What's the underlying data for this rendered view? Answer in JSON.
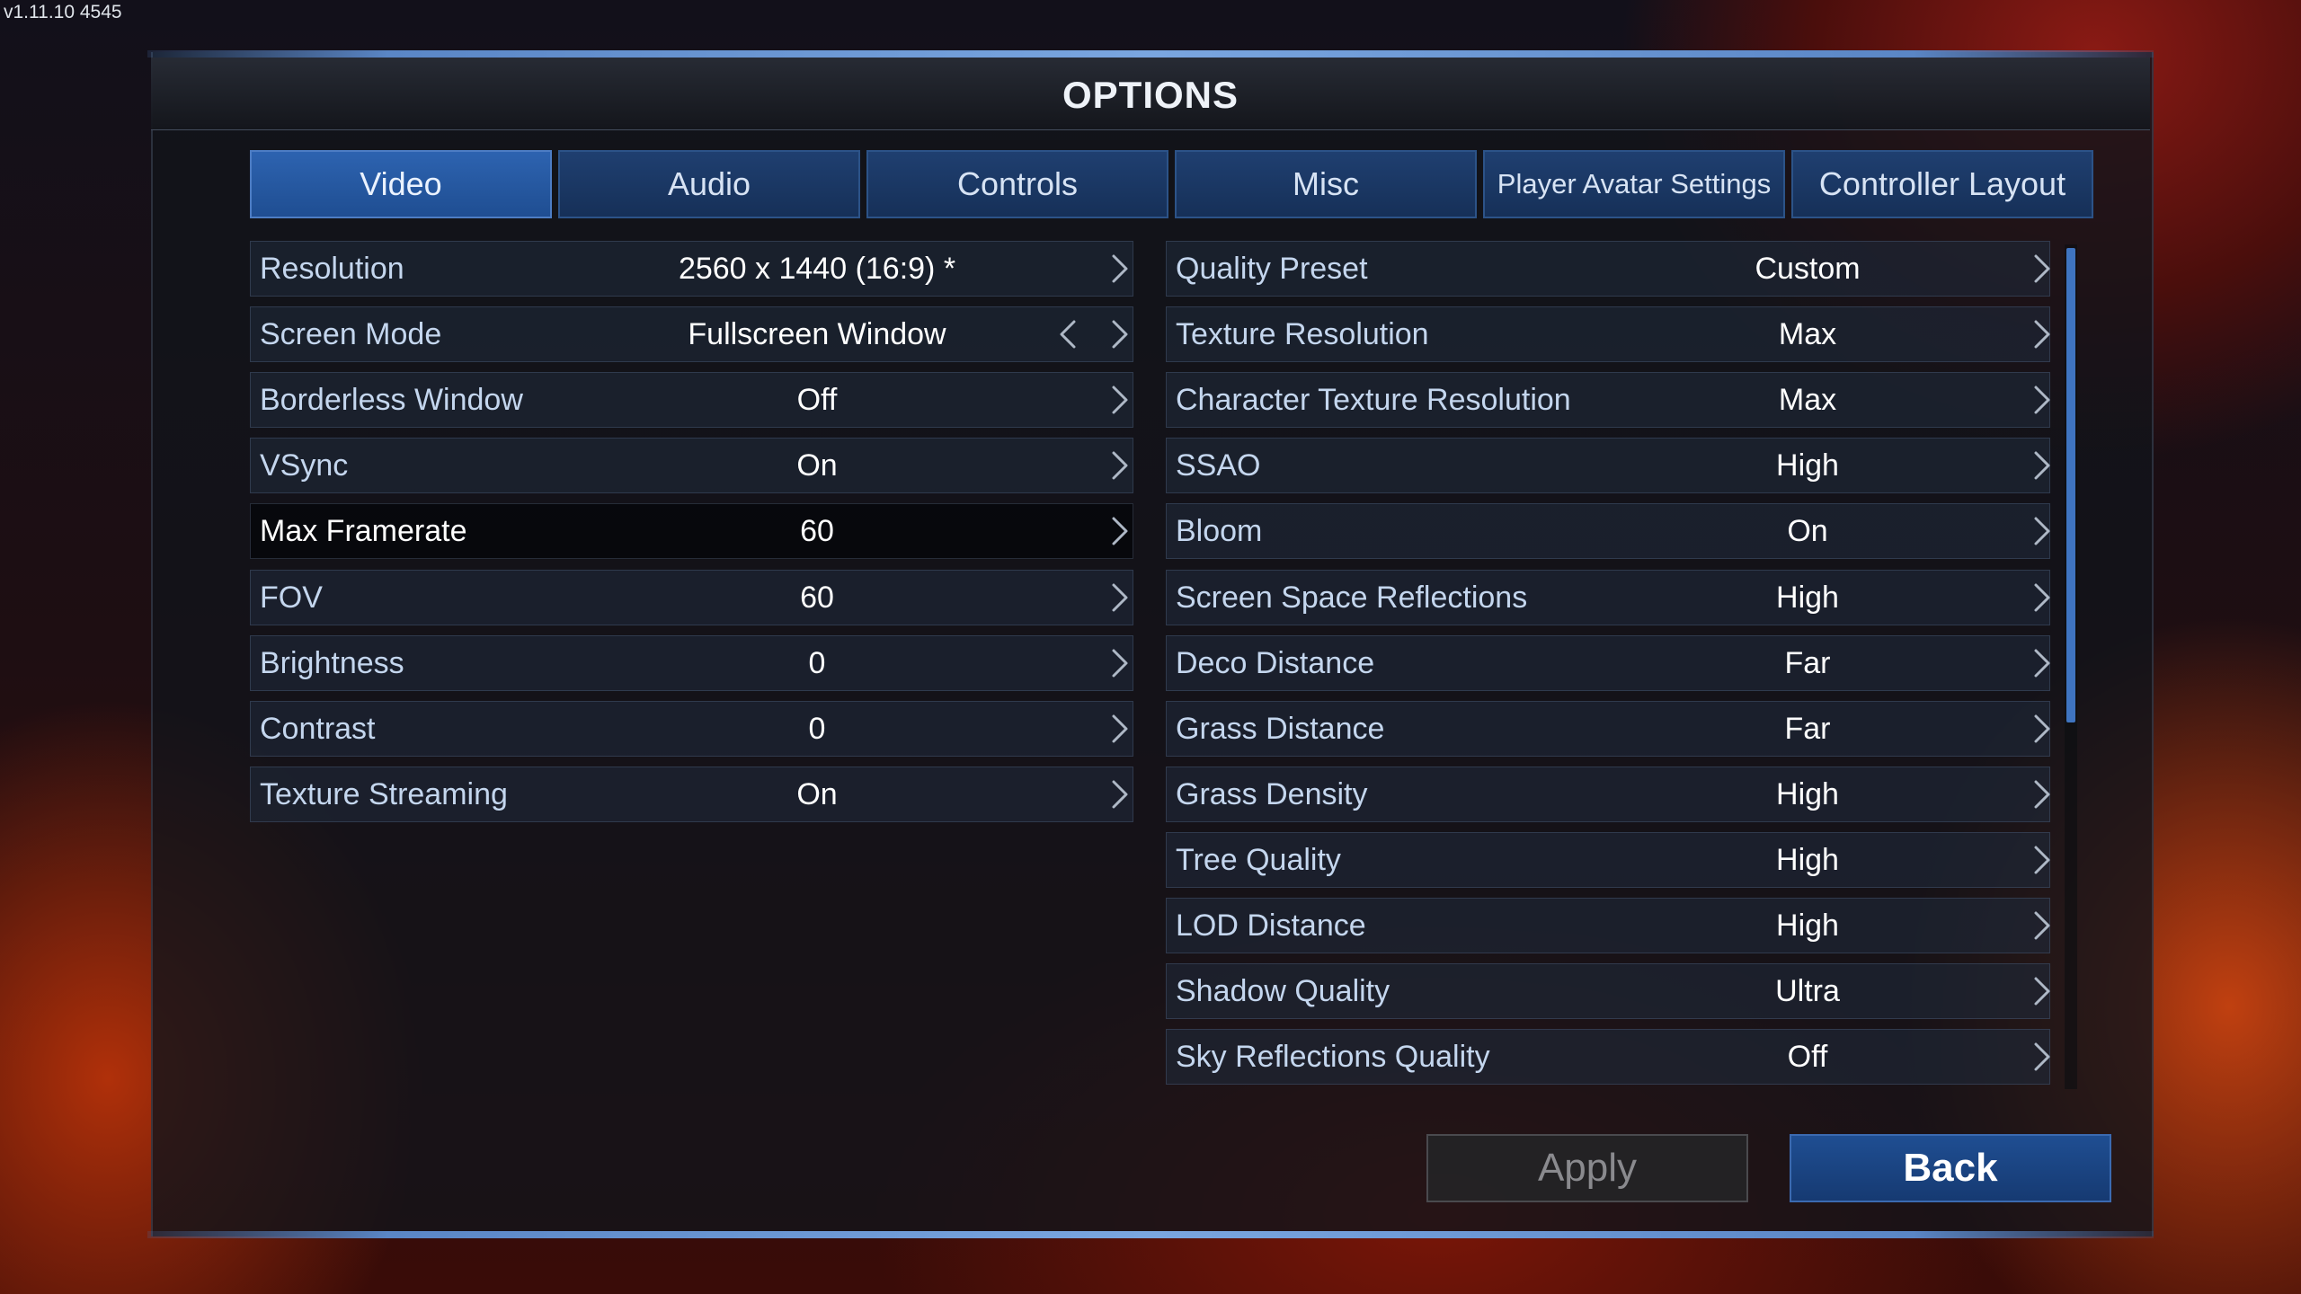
{
  "version": "v1.11.10 4545",
  "title": "OPTIONS",
  "tabs": [
    {
      "label": "Video",
      "active": true
    },
    {
      "label": "Audio",
      "active": false
    },
    {
      "label": "Controls",
      "active": false
    },
    {
      "label": "Misc",
      "active": false
    },
    {
      "label": "Player Avatar Settings",
      "active": false
    },
    {
      "label": "Controller Layout",
      "active": false
    }
  ],
  "left_settings": [
    {
      "label": "Resolution",
      "value": "2560 x 1440  (16:9)  *"
    },
    {
      "label": "Screen Mode",
      "value": "Fullscreen Window"
    },
    {
      "label": "Borderless Window",
      "value": "Off"
    },
    {
      "label": "VSync",
      "value": "On"
    },
    {
      "label": "Max Framerate",
      "value": "60"
    },
    {
      "label": "FOV",
      "value": "60"
    },
    {
      "label": "Brightness",
      "value": "0"
    },
    {
      "label": "Contrast",
      "value": "0"
    },
    {
      "label": "Texture Streaming",
      "value": "On"
    }
  ],
  "right_settings": [
    {
      "label": "Quality Preset",
      "value": "Custom"
    },
    {
      "label": "Texture Resolution",
      "value": "Max"
    },
    {
      "label": "Character Texture Resolution",
      "value": "Max"
    },
    {
      "label": "SSAO",
      "value": "High"
    },
    {
      "label": "Bloom",
      "value": "On"
    },
    {
      "label": "Screen Space Reflections",
      "value": "High"
    },
    {
      "label": "Deco Distance",
      "value": "Far"
    },
    {
      "label": "Grass Distance",
      "value": "Far"
    },
    {
      "label": "Grass Density",
      "value": "High"
    },
    {
      "label": "Tree Quality",
      "value": "High"
    },
    {
      "label": "LOD Distance",
      "value": "High"
    },
    {
      "label": "Shadow Quality",
      "value": "Ultra"
    },
    {
      "label": "Sky Reflections Quality",
      "value": "Off"
    }
  ],
  "buttons": {
    "apply": "Apply",
    "back": "Back"
  },
  "colors": {
    "accent": "#2d63b0",
    "tab": "#1f3f70",
    "scroll_thumb": "#3f74c0"
  }
}
